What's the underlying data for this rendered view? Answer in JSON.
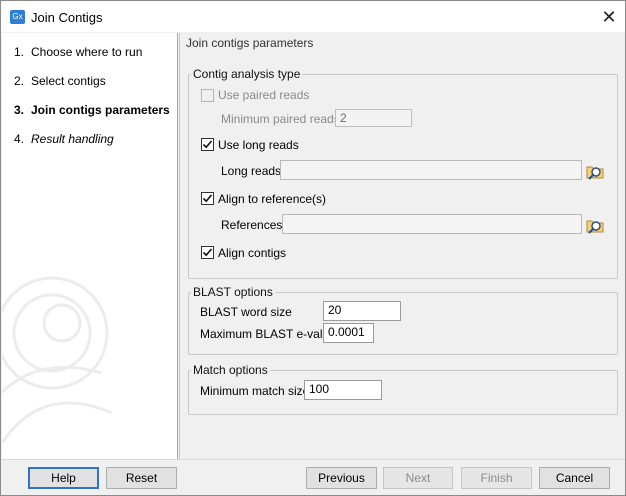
{
  "window": {
    "title": "Join Contigs",
    "app_icon_text": "Gx"
  },
  "steps": [
    {
      "num": "1.",
      "label": "Choose where to run"
    },
    {
      "num": "2.",
      "label": "Select contigs"
    },
    {
      "num": "3.",
      "label": "Join contigs parameters"
    },
    {
      "num": "4.",
      "label": "Result handling"
    }
  ],
  "content": {
    "title": "Join contigs parameters",
    "contig_analysis": {
      "legend": "Contig analysis type",
      "use_paired_reads": {
        "label": "Use paired reads",
        "checked": false,
        "enabled": false
      },
      "min_paired_reads": {
        "label": "Minimum paired reads",
        "value": "2"
      },
      "use_long_reads": {
        "label": "Use long reads",
        "checked": true
      },
      "long_reads": {
        "label": "Long reads",
        "value": ""
      },
      "align_to_reference": {
        "label": "Align to reference(s)",
        "checked": true
      },
      "references": {
        "label": "References",
        "value": ""
      },
      "align_contigs": {
        "label": "Align contigs",
        "checked": true
      }
    },
    "blast_options": {
      "legend": "BLAST options",
      "word_size": {
        "label": "BLAST word size",
        "value": "20"
      },
      "max_evalue": {
        "label": "Maximum BLAST e-value",
        "value": "0.0001"
      }
    },
    "match_options": {
      "legend": "Match options",
      "min_match_size": {
        "label": "Minimum match size",
        "value": "100"
      }
    }
  },
  "buttons": {
    "help": "Help",
    "reset": "Reset",
    "previous": "Previous",
    "next": "Next",
    "finish": "Finish",
    "cancel": "Cancel"
  }
}
